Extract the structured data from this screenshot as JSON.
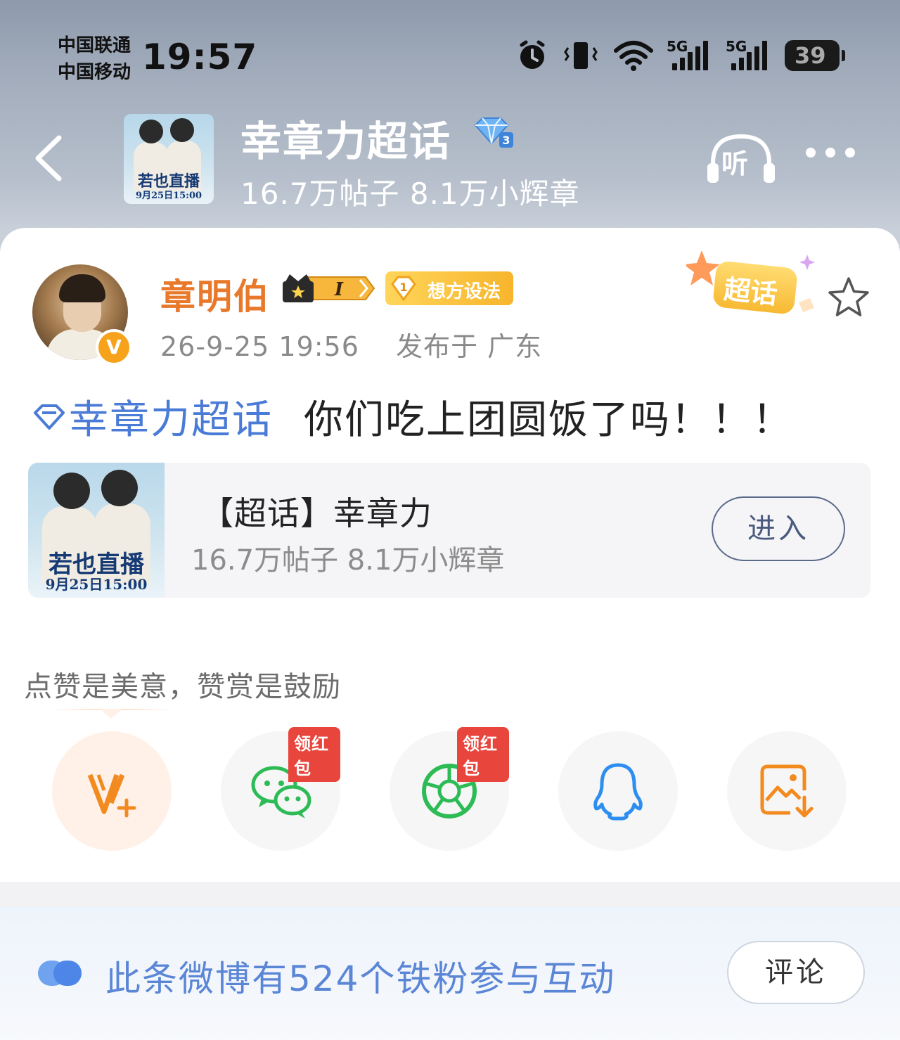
{
  "status_bar": {
    "carrier_1": "中国联通",
    "carrier_2": "中国移动",
    "time": "19:57",
    "net_1": "5G",
    "net_2": "5G",
    "battery": "39",
    "icons": [
      "alarm-icon",
      "vibrate-icon",
      "wifi-icon",
      "signal-icon",
      "signal-icon",
      "battery-icon"
    ]
  },
  "header": {
    "topic_title": "幸章力超话",
    "topic_stats": "16.7万帖子 8.1万小辉章",
    "cover_title": "若也直播",
    "cover_date": "9月25日15:00",
    "listen_label": "听",
    "level_badge": "3"
  },
  "post": {
    "author": "章明伯",
    "crown_level": "I",
    "fan_badge_number": "1",
    "fan_badge_label": "想方设法",
    "verified": "V",
    "date": "26-9-25 19:56",
    "location": "发布于 广东",
    "sticker": "超话",
    "topic_link": "幸章力超话",
    "body": "你们吃上团圆饭了吗！！！",
    "topic_card": {
      "title": "【超话】幸章力",
      "stats": "16.7万帖子 8.1万小辉章",
      "thumb_title": "若也直播",
      "thumb_date": "9月25日15:00",
      "enter_label": "进入"
    }
  },
  "reward": {
    "hint": "点赞是美意，赞赏是鼓励",
    "share_items": [
      {
        "name": "reward-v-icon",
        "badge": ""
      },
      {
        "name": "wechat-icon",
        "badge": "领红包"
      },
      {
        "name": "moments-icon",
        "badge": "领红包"
      },
      {
        "name": "qq-icon",
        "badge": ""
      },
      {
        "name": "save-image-icon",
        "badge": ""
      }
    ]
  },
  "footer": {
    "fan_text": "此条微博有524个铁粉参与互动",
    "comment_label": "评论"
  },
  "colors": {
    "author": "#e8782a",
    "topic_link": "#4a7bd6",
    "fan_text": "#5b86d6",
    "redpack": "#e8453c",
    "wechat": "#2dbb55",
    "qq": "#2d8ef0",
    "save": "#f28a20"
  }
}
